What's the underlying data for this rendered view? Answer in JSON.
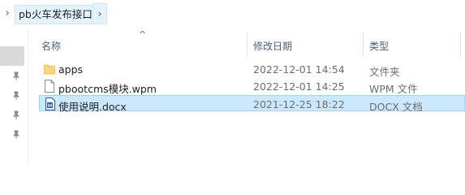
{
  "breadcrumb": {
    "folder": "pb火车发布接口"
  },
  "columns": {
    "name": "名称",
    "modified": "修改日期",
    "type": "类型"
  },
  "files": [
    {
      "name": "apps",
      "modified": "2022-12-01 14:54",
      "type": "文件夹",
      "icon": "folder-icon"
    },
    {
      "name": "pbootcms模块.wpm",
      "modified": "2022-12-01 14:25",
      "type": "WPM 文件",
      "icon": "file-icon"
    },
    {
      "name": "使用说明.docx",
      "modified": "2021-12-25 18:22",
      "type": "DOCX 文档",
      "icon": "docx-icon",
      "selected": true
    }
  ],
  "colors": {
    "selection": "#cce8ff",
    "selection_border": "#99d1ff",
    "folder": "#f8d775"
  }
}
